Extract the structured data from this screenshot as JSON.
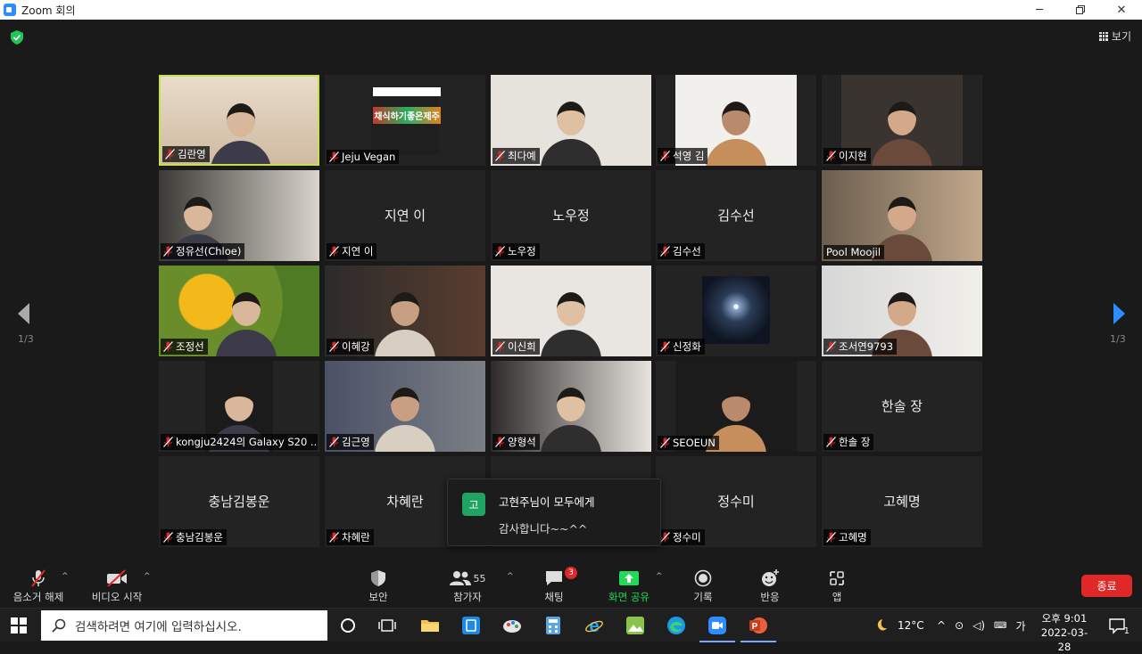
{
  "window": {
    "title": "Zoom 회의"
  },
  "view": {
    "label": "보기"
  },
  "page": {
    "left": "1/3",
    "right": "1/3"
  },
  "participants": [
    {
      "name": "김란영",
      "video": true,
      "active": true
    },
    {
      "name": "Jeju Vegan",
      "video": true,
      "poster_text": "채식하기좋은제주"
    },
    {
      "name": "최다예",
      "video": true
    },
    {
      "name": "석영 김",
      "video": true
    },
    {
      "name": "이지현",
      "video": true
    },
    {
      "name": "정유선(Chloe)",
      "video": true
    },
    {
      "name": "지연 이",
      "video": false
    },
    {
      "name": "노우정",
      "video": false
    },
    {
      "name": "김수선",
      "video": false
    },
    {
      "name": "Pool Moojil",
      "video": true,
      "unmuted": true
    },
    {
      "name": "조정선",
      "video": true
    },
    {
      "name": "이혜강",
      "video": true
    },
    {
      "name": "이신희",
      "video": true
    },
    {
      "name": "신정화",
      "video": true
    },
    {
      "name": "조서연9793",
      "video": true
    },
    {
      "name": "kongju2424의 Galaxy S20 ...",
      "video": true
    },
    {
      "name": "김근영",
      "video": true
    },
    {
      "name": "양형석",
      "video": true
    },
    {
      "name": "SEOEUN",
      "video": true
    },
    {
      "name": "한솔 장",
      "video": false
    },
    {
      "name": "충남김봉운",
      "video": false
    },
    {
      "name": "차혜란",
      "video": false
    },
    {
      "name": "",
      "video": false,
      "hidden": true
    },
    {
      "name": "정수미",
      "video": false
    },
    {
      "name": "고혜명",
      "video": false
    }
  ],
  "chat_popup": {
    "avatar": "고",
    "from": "고현주님이 모두에게",
    "message": "감사합니다~~^^"
  },
  "toolbar": {
    "unmute": "음소거 해제",
    "start_video": "비디오 시작",
    "security": "보안",
    "participants": "참가자",
    "participants_count": "55",
    "chat": "채팅",
    "chat_badge": "3",
    "share_screen": "화면 공유",
    "record": "기록",
    "reactions": "반응",
    "apps": "앱",
    "end": "종료"
  },
  "taskbar": {
    "search_placeholder": "검색하려면 여기에 입력하십시오.",
    "weather": "12°C",
    "ime": "가",
    "time": "오후 9:01",
    "date": "2022-03-28",
    "notifications": "1"
  },
  "colors": {
    "active_speaker": "#c4e04a",
    "end_button": "#e02828",
    "share_green": "#23d959",
    "chat_avatar": "#1fa463",
    "muted_red": "#e02828"
  }
}
